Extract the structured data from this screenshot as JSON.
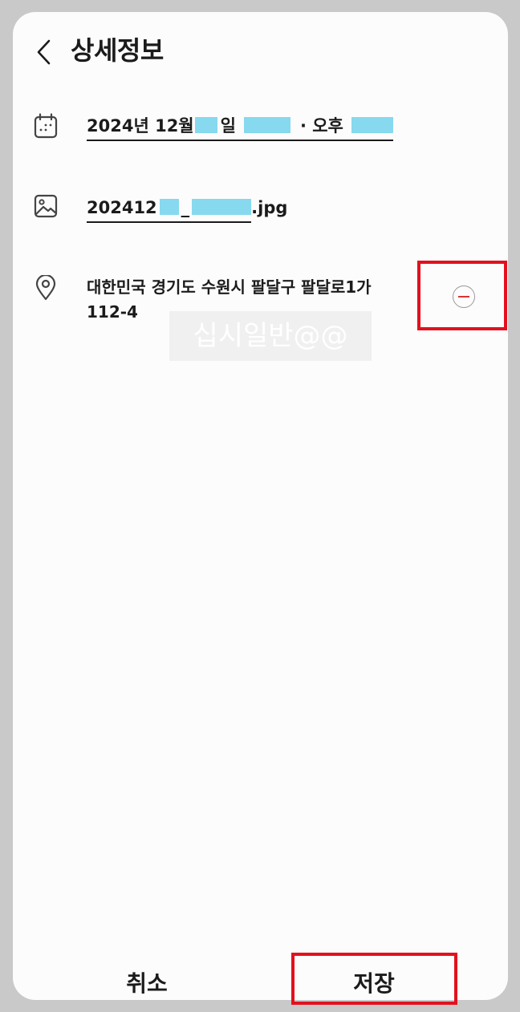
{
  "header": {
    "title": "상세정보",
    "back_icon": "chevron-left-icon"
  },
  "date_row": {
    "icon": "calendar-icon",
    "date_prefix": "2024년 12월",
    "day_suffix": "일",
    "separator": "· 오후"
  },
  "file_row": {
    "icon": "image-icon",
    "name_prefix": "202412",
    "underscore": "_",
    "extension": ".jpg"
  },
  "location_row": {
    "icon": "location-pin-icon",
    "address_line1": "대한민국 경기도 수원시 팔달구 팔달로1가",
    "address_line2": "112-4",
    "remove_icon": "remove-circle-icon"
  },
  "watermark": {
    "text": "십시일반@@"
  },
  "footer": {
    "cancel_label": "취소",
    "save_label": "저장"
  },
  "colors": {
    "background": "#c9c9c9",
    "sheet": "#fcfcfc",
    "text": "#1b1b1b",
    "redaction": "#86d9ee",
    "highlight": "#e2111e",
    "remove_accent": "#d7343b"
  }
}
